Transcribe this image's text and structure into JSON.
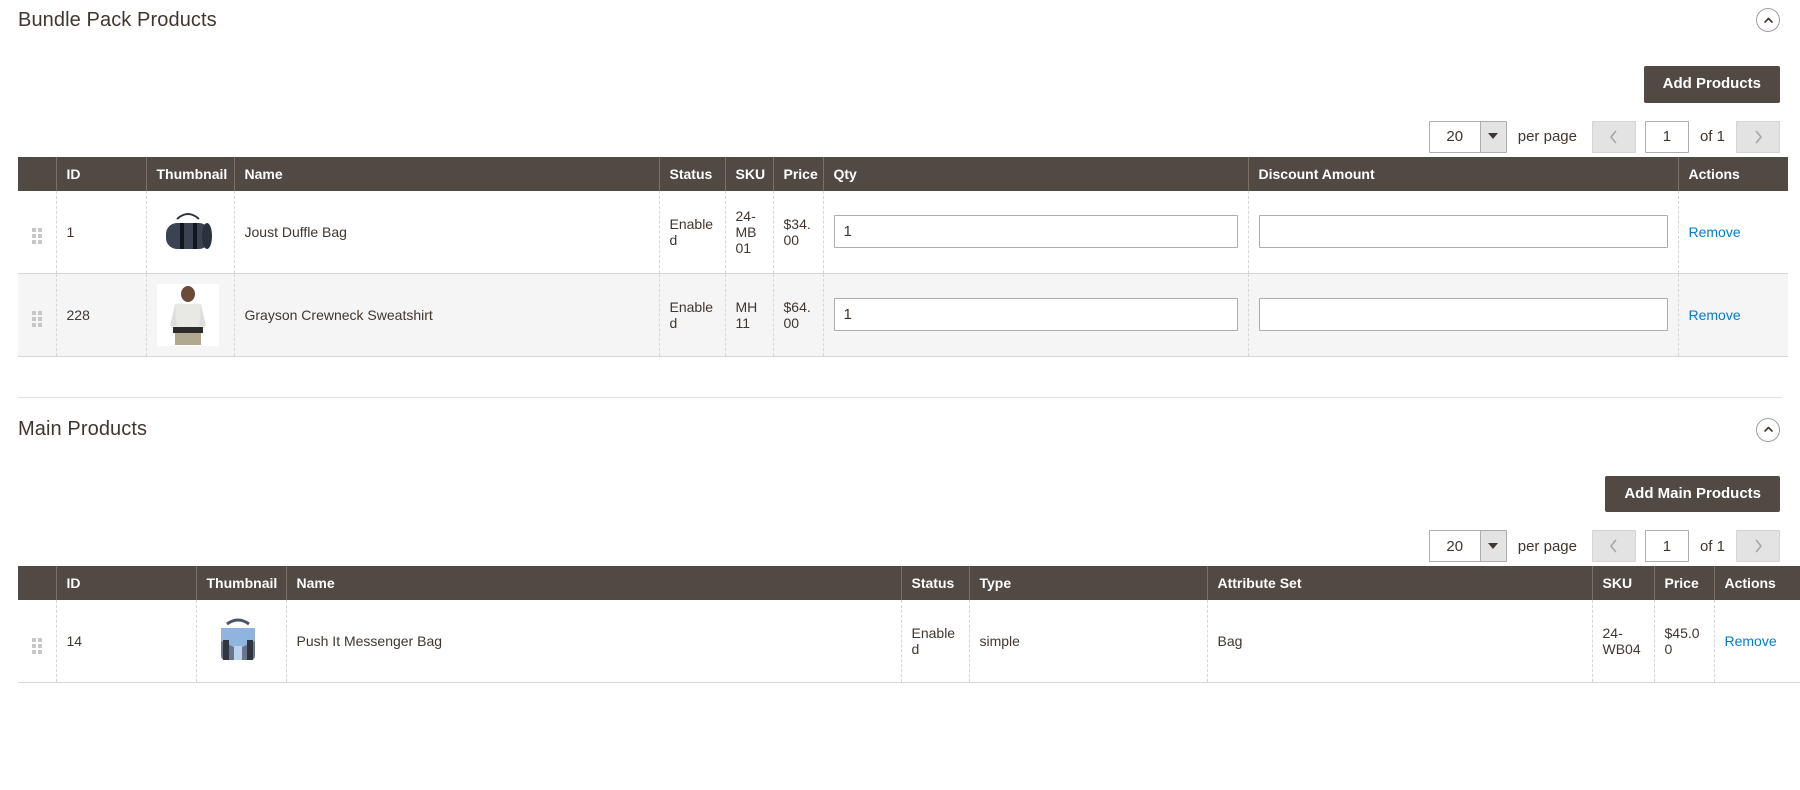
{
  "bundle_section": {
    "title": "Bundle Pack Products",
    "collapse_icon": "chevron-up-circle-icon",
    "add_button_label": "Add Products",
    "pager": {
      "per_page_value": "20",
      "per_page_label": "per page",
      "prev_icon": "chevron-left-icon",
      "next_icon": "chevron-right-icon",
      "page_value": "1",
      "of_label": "of 1"
    },
    "columns": [
      "ID",
      "Thumbnail",
      "Name",
      "Status",
      "SKU",
      "Price",
      "Qty",
      "Discount Amount",
      "Actions"
    ],
    "rows": [
      {
        "id": "1",
        "thumbnail": "duffle-bag-thumbnail",
        "name": "Joust Duffle Bag",
        "status": "Enabled",
        "sku": "24-MB01",
        "price": "$34.00",
        "qty": "1",
        "discount_amount": "",
        "action_label": "Remove"
      },
      {
        "id": "228",
        "thumbnail": "sweatshirt-thumbnail",
        "name": "Grayson Crewneck Sweatshirt",
        "status": "Enabled",
        "sku": "MH11",
        "price": "$64.00",
        "qty": "1",
        "discount_amount": "",
        "action_label": "Remove"
      }
    ]
  },
  "main_section": {
    "title": "Main Products",
    "collapse_icon": "chevron-up-circle-icon",
    "add_button_label": "Add Main Products",
    "pager": {
      "per_page_value": "20",
      "per_page_label": "per page",
      "prev_icon": "chevron-left-icon",
      "next_icon": "chevron-right-icon",
      "page_value": "1",
      "of_label": "of 1"
    },
    "columns": [
      "ID",
      "Thumbnail",
      "Name",
      "Status",
      "Type",
      "Attribute Set",
      "SKU",
      "Price",
      "Actions"
    ],
    "rows": [
      {
        "id": "14",
        "thumbnail": "messenger-bag-thumbnail",
        "name": "Push It Messenger Bag",
        "status": "Enabled",
        "type": "simple",
        "attribute_set": "Bag",
        "sku": "24-WB04",
        "price": "$45.00",
        "action_label": "Remove"
      }
    ]
  },
  "colors": {
    "header_bg": "#514943",
    "text": "#41362f",
    "link": "#007bdb",
    "row_alt": "#f5f5f5",
    "border": "#d6d6d6"
  }
}
